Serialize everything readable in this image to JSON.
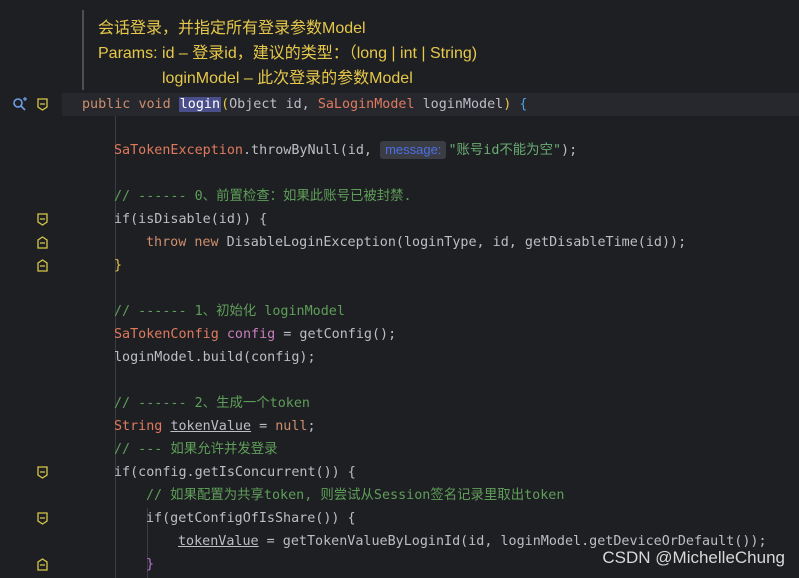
{
  "doc": {
    "line1": "会话登录，并指定所有登录参数Model",
    "line2": "Params: id – 登录id，建议的类型：（long | int | String)",
    "line3": "loginModel – 此次登录的参数Model"
  },
  "code": {
    "sig": {
      "public": "public",
      "void": "void",
      "name": "login",
      "open": "(",
      "p1type": "Object",
      "p1name": "id,",
      "p2type": "SaLoginModel",
      "p2name": "loginModel",
      "close": ")",
      "brace": "{"
    },
    "l1": {
      "cls": "SaTokenException",
      "call": ".throwByNull(id, ",
      "hint": "message:",
      "str": "\"账号id不能为空\"",
      "end": ");"
    },
    "c0": "// ------ 0、前置检查：如果此账号已被封禁.",
    "if1": "if(isDisable(id)) {",
    "throw": "throw",
    "new": "new",
    "throw_rest": "DisableLoginException(loginType, id, getDisableTime(id));",
    "close1": "}",
    "c1": "// ------ 1、初始化 loginModel",
    "cfg_type": "SaTokenConfig",
    "cfg_var": "config",
    "cfg_rest": " = getConfig();",
    "build": "loginModel.build(config);",
    "c2": "// ------ 2、生成一个token",
    "str_type": "String",
    "token_var": "tokenValue",
    "eq": " = ",
    "null_kw": "null",
    "semi": ";",
    "c3": "// --- 如果允许并发登录",
    "if2": "if(config.getIsConcurrent()) {",
    "c4": "// 如果配置为共享token, 则尝试从Session签名记录里取出token",
    "if3": "if(getConfigOfIsShare()) {",
    "assign_rest": " = getTokenValueByLoginId(id, loginModel.getDeviceOrDefault());",
    "close3": "}"
  },
  "watermark": "CSDN @MichelleChung"
}
